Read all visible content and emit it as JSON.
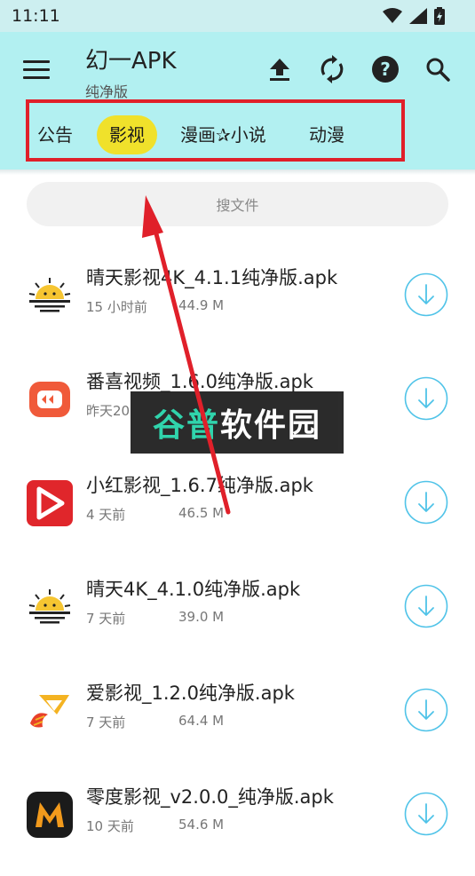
{
  "status_bar": {
    "time": "11:11"
  },
  "app_bar": {
    "title": "幻一APK",
    "subtitle": "纯净版",
    "actions": [
      "upload-icon",
      "refresh-icon",
      "help-icon",
      "search-icon"
    ]
  },
  "tabs": [
    {
      "label": "公告",
      "active": false
    },
    {
      "label": "影视",
      "active": true
    },
    {
      "label": "漫画✰小说",
      "active": false
    },
    {
      "label": "动漫",
      "active": false
    }
  ],
  "search": {
    "placeholder": "搜文件"
  },
  "files": [
    {
      "name": "晴天影视4K_4.1.1纯净版.apk",
      "time": "15 小时前",
      "size": "44.9 M"
    },
    {
      "name": "番喜视频_1.6.0纯净版.apk",
      "time": "昨天20",
      "size": ""
    },
    {
      "name": "小红影视_1.6.7纯净版.apk",
      "time": "4 天前",
      "size": "46.5 M"
    },
    {
      "name": "晴天4K_4.1.0纯净版.apk",
      "time": "7 天前",
      "size": "39.0 M"
    },
    {
      "name": "爱影视_1.2.0纯净版.apk",
      "time": "7 天前",
      "size": "64.4 M"
    },
    {
      "name": "零度影视_v2.0.0_纯净版.apk",
      "time": "10 天前",
      "size": "54.6 M"
    }
  ],
  "watermark": {
    "text_a": "谷普",
    "text_b": "软件园"
  },
  "colors": {
    "appbar": "#b2f0f1",
    "active_tab": "#f0e12b",
    "annotation": "#e0202a",
    "download": "#4fc3e8"
  }
}
